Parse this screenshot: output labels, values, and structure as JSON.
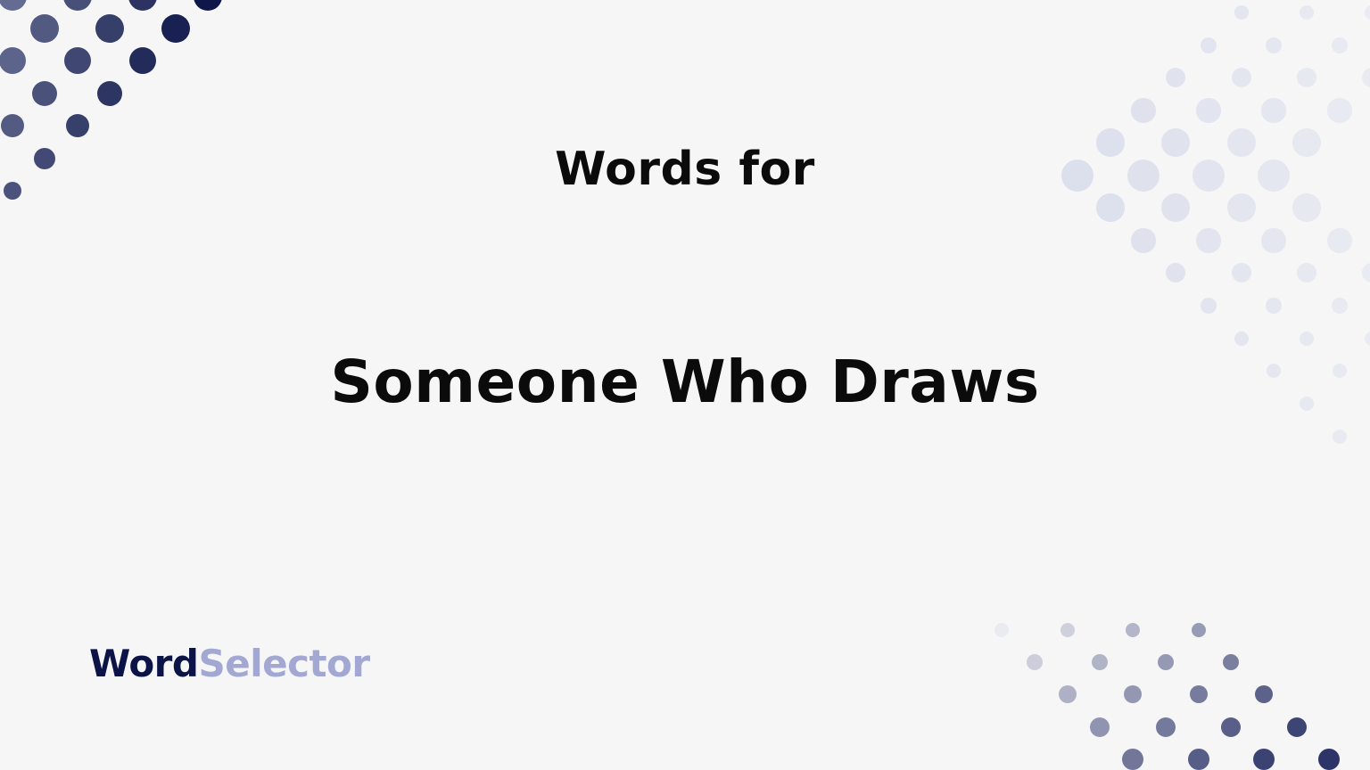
{
  "header": {
    "kicker": "Words for",
    "title": "Someone Who Draws"
  },
  "brand": {
    "part1": "Word",
    "part2": "Selector",
    "color_dark": "#0c1447",
    "color_light": "#a3a8d3"
  },
  "colors": {
    "background": "#f6f6f6",
    "dots_dark": "#0c1447",
    "dots_light": "#dfe1ec"
  }
}
